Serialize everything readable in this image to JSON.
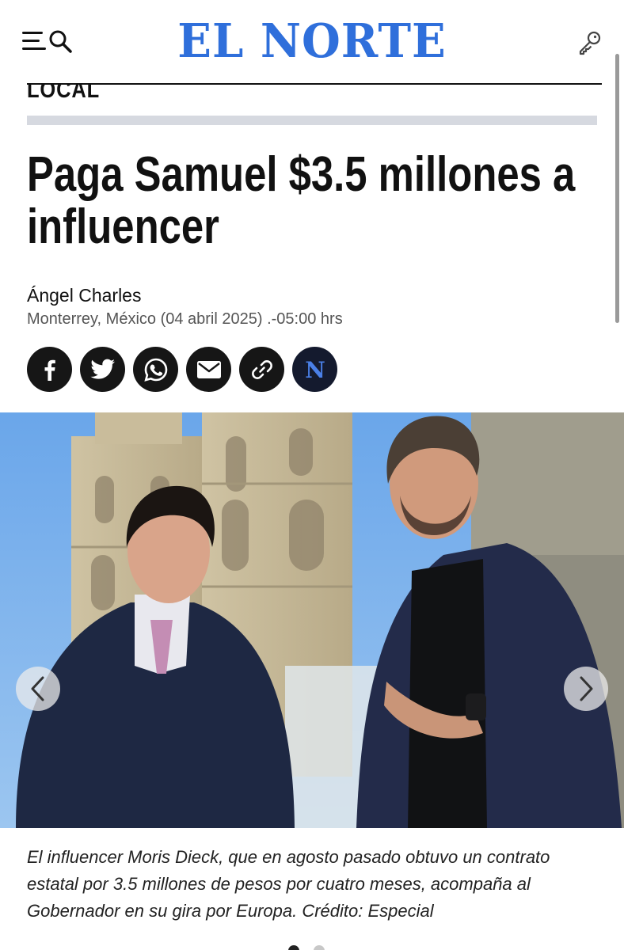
{
  "header": {
    "logo_text": "EL NORTE",
    "menu_icon": "menu-icon",
    "search_icon": "search-icon",
    "login_icon": "key-icon",
    "brand_color": "#2f6fdb"
  },
  "article": {
    "section": "LOCAL",
    "headline": "Paga Samuel $3.5 millones a influencer",
    "author": "Ángel Charles",
    "dateline": "Monterrey, México (04 abril 2025) .-05:00 hrs"
  },
  "share": {
    "buttons": [
      {
        "name": "facebook",
        "icon": "facebook-icon"
      },
      {
        "name": "twitter",
        "icon": "twitter-icon"
      },
      {
        "name": "whatsapp",
        "icon": "whatsapp-icon"
      },
      {
        "name": "email",
        "icon": "email-icon"
      },
      {
        "name": "copy-link",
        "icon": "link-icon"
      },
      {
        "name": "el-norte",
        "icon": "el-norte-icon",
        "label": "N"
      }
    ]
  },
  "gallery": {
    "caption": "El influencer Moris Dieck, que en agosto pasado obtuvo un contrato estatal por 3.5 millones de pesos por cuatro meses, acompaña al Gobernador en su gira por Europa. Crédito: Especial",
    "prev_icon": "chevron-left-icon",
    "next_icon": "chevron-right-icon",
    "current_slide": 1,
    "total_slides": 2
  }
}
